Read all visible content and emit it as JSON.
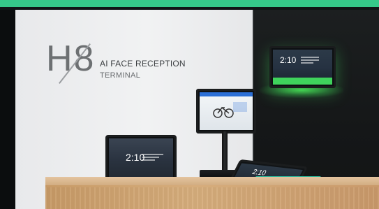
{
  "brand": {
    "model": "H8",
    "tagline_line1": "AI FACE RECEPTION",
    "tagline_line2": "TERMINAL"
  },
  "screens": {
    "wall_time": "2:10",
    "left_tablet_time": "2:10",
    "flat_tablet_time": "2:10"
  },
  "colors": {
    "top_bar": "#35c98a",
    "accent_green_glow": "#3fd35c",
    "left_wall": "#eeeeef",
    "right_wall": "#17191a",
    "counter_wood": "#d2ad82"
  }
}
